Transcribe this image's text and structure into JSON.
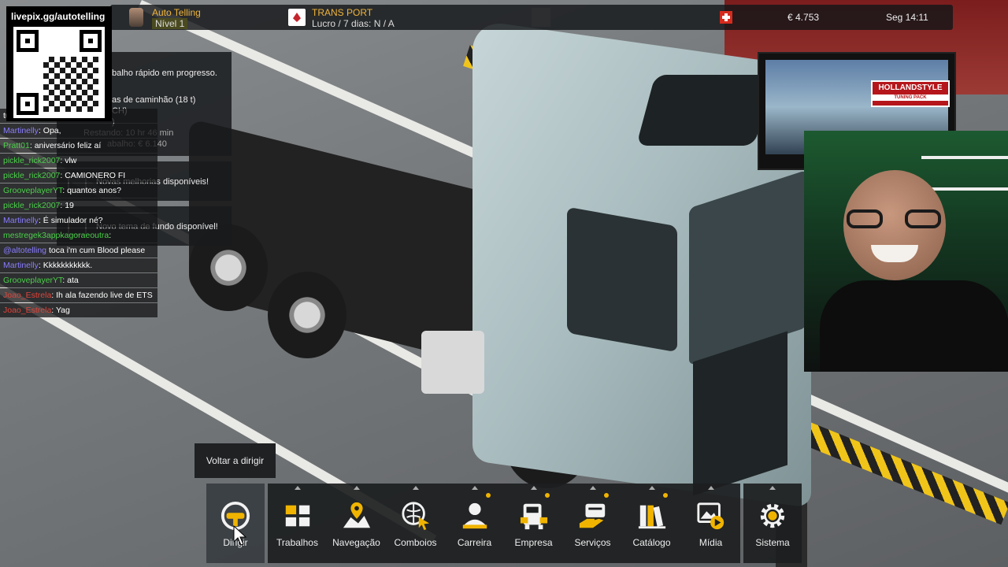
{
  "topbar": {
    "driver_name": "Auto Telling",
    "level": "Nível 1",
    "company_name": "TRANS PORT",
    "company_profit": "Lucro / 7 dias: N / A",
    "money": "€ 4.753",
    "clock": "Seg 14:11"
  },
  "qr": {
    "url": "livepix.gg/autotelling"
  },
  "notifications": {
    "job_lines": [
      "balho rápido em progresso.",
      "as de caminhão (18 t)",
      "CH)",
      ")",
      "Restando: 10 hr 46 min",
      "abalho: € 6.140"
    ],
    "upgrades": "Novas melhorias disponíveis!",
    "theme": "Novo tema de fundo disponível!"
  },
  "chat": {
    "rows": [
      {
        "user": "",
        "msg": "tu estás?",
        "color": "#ffffff"
      },
      {
        "user": "Martinelly",
        "msg": ": Opa,",
        "color": "#8a7dff"
      },
      {
        "user": "Pratt01",
        "msg": ": aniversário feliz aí",
        "color": "#4ad04a"
      },
      {
        "user": "pickle_rick2007",
        "msg": ": vlw",
        "color": "#4ad04a"
      },
      {
        "user": "pickle_rick2007",
        "msg": ": CAMIONERO FI",
        "color": "#4ad04a"
      },
      {
        "user": "GrooveplayerYT",
        "msg": ": quantos anos?",
        "color": "#4ad04a"
      },
      {
        "user": "pickle_rick2007",
        "msg": ": 19",
        "color": "#4ad04a"
      },
      {
        "user": "Martinelly",
        "msg": ": É simulador né?",
        "color": "#8a7dff"
      },
      {
        "user": "mestregek3appkagoraeoutra",
        "msg": ":",
        "color": "#4ad04a"
      },
      {
        "user": "@altotelling",
        "msg": " toca i'm cum Blood please",
        "color": "#8a7dff"
      },
      {
        "user": "Martinelly",
        "msg": ": Kkkkkkkkkkk.",
        "color": "#8a7dff"
      },
      {
        "user": "GrooveplayerYT",
        "msg": ": ata",
        "color": "#4ad04a"
      },
      {
        "user": "Joao_Estrela",
        "msg": ": Ih ala fazendo live de ETS",
        "color": "#e0443a"
      },
      {
        "user": "Joao_Estrela",
        "msg": ": Yag",
        "color": "#e0443a"
      }
    ]
  },
  "ad": {
    "brand": "HOLLANDSTYLE",
    "sub": "TUNING PACK"
  },
  "tooltip": "Voltar a dirigir",
  "menu": {
    "dirigir": "Dirigir",
    "trabalhos": "Trabalhos",
    "navegacao": "Navegação",
    "comboios": "Comboios",
    "carreira": "Carreira",
    "empresa": "Empresa",
    "servicos": "Serviços",
    "catalogo": "Catálogo",
    "midia": "Mídia",
    "sistema": "Sistema"
  },
  "colors": {
    "accent": "#f0b400",
    "hud_bg": "#141618",
    "menu_bg": "#1c1e20"
  }
}
